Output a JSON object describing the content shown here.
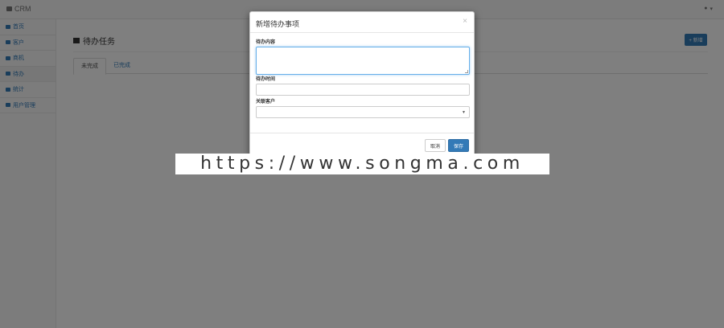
{
  "navbar": {
    "brand": "CRM",
    "user_icon": "user-icon"
  },
  "sidebar": {
    "items": [
      {
        "label": "首页",
        "icon": "dashboard-icon"
      },
      {
        "label": "客户",
        "icon": "users-icon"
      },
      {
        "label": "商机",
        "icon": "table-icon"
      },
      {
        "label": "待办",
        "icon": "edit-icon"
      },
      {
        "label": "统计",
        "icon": "chart-icon"
      },
      {
        "label": "用户管理",
        "icon": "user-manage-icon"
      }
    ]
  },
  "main": {
    "title": "待办任务",
    "add_button": "+ 新增",
    "tabs": [
      {
        "label": "未完成"
      },
      {
        "label": "已完成"
      }
    ]
  },
  "modal": {
    "title": "新增待办事项",
    "close": "×",
    "fields": {
      "content_label": "待办内容",
      "time_label": "待办时间",
      "customer_label": "关联客户"
    },
    "cancel": "取消",
    "save": "保存"
  },
  "watermark": "https://www.songma.com",
  "colors": {
    "primary": "#337ab7",
    "focus": "#66afe9"
  }
}
